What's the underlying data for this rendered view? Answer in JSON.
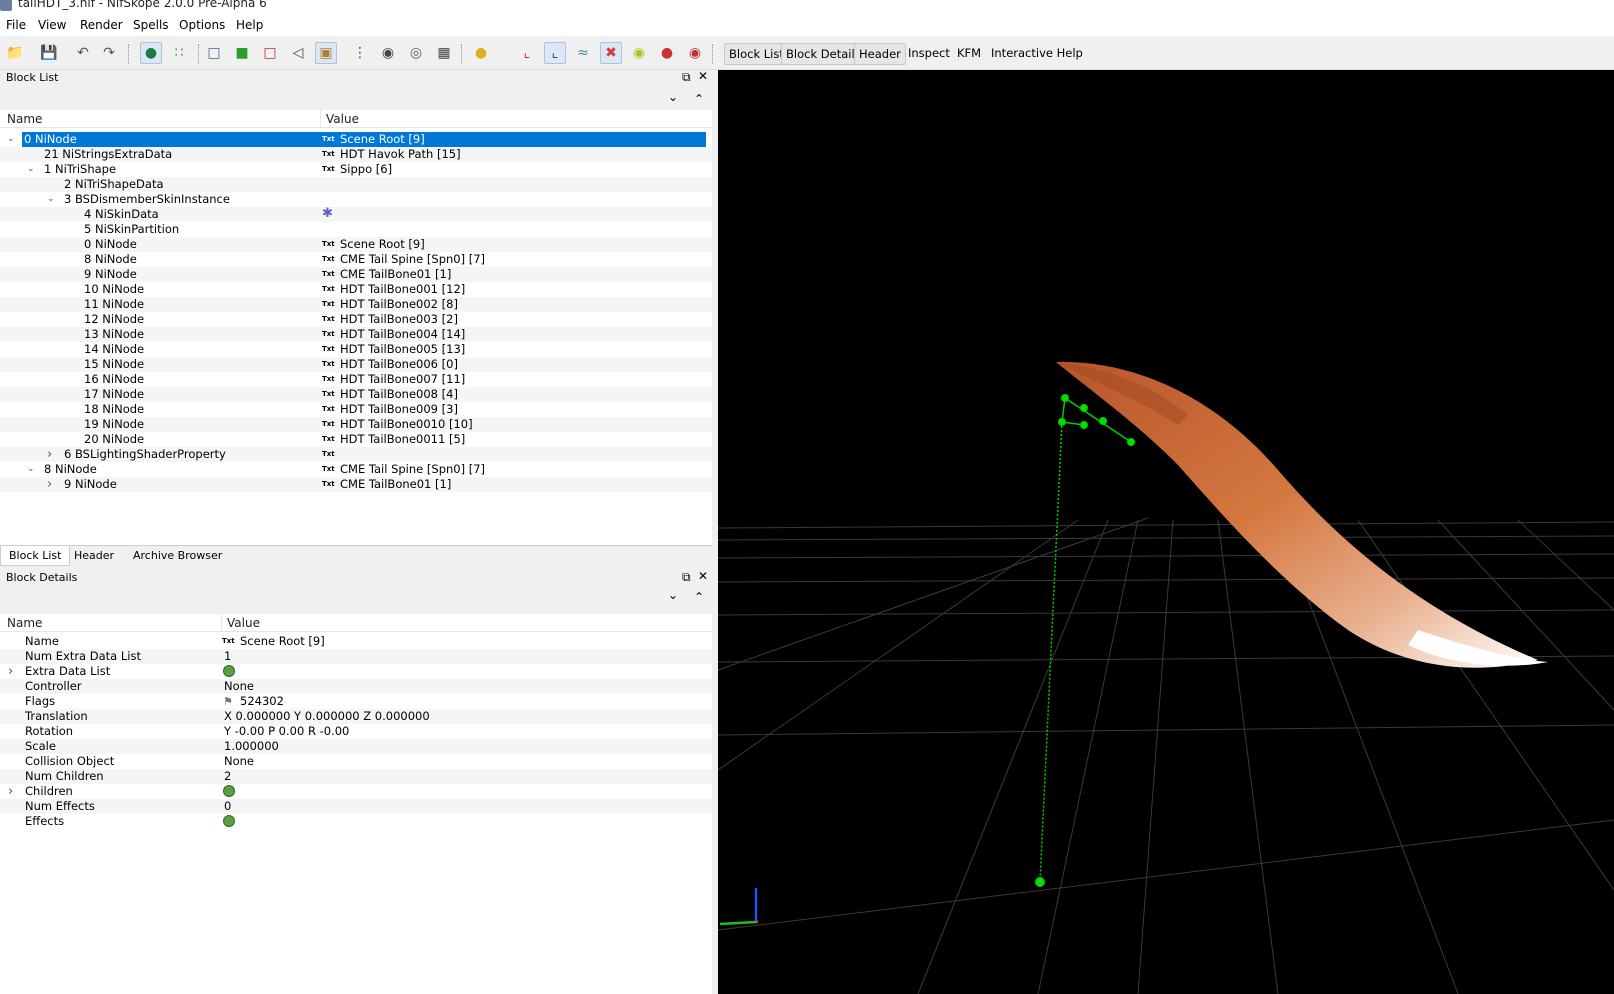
{
  "window": {
    "title": "tailHDT_3.nif - NifSkope 2.0.0 Pre-Alpha 6"
  },
  "menu": [
    "File",
    "View",
    "Render",
    "Spells",
    "Options",
    "Help"
  ],
  "toolbar": {
    "view_buttons": [
      "Block List",
      "Block Details",
      "Header",
      "Inspect",
      "KFM",
      "Interactive Help"
    ]
  },
  "block_list": {
    "title": "Block List",
    "col_name": "Name",
    "col_value": "Value",
    "rows": [
      {
        "name": "0 NiNode",
        "value": "Scene Root [9]",
        "txt": true,
        "exp": "v",
        "indent": 0
      },
      {
        "name": "21 NiStringsExtraData",
        "value": "HDT Havok Path [15]",
        "txt": true,
        "exp": "",
        "indent": 1
      },
      {
        "name": "1 NiTriShape",
        "value": "Sippo [6]",
        "txt": true,
        "exp": "v",
        "indent": 1
      },
      {
        "name": "2 NiTriShapeData",
        "value": "",
        "txt": false,
        "exp": "",
        "indent": 2
      },
      {
        "name": "3 BSDismemberSkinInstance",
        "value": "",
        "txt": false,
        "exp": "v",
        "indent": 2
      },
      {
        "name": "4 NiSkinData",
        "value": "",
        "txt": false,
        "exp": "",
        "indent": 3,
        "star": true
      },
      {
        "name": "5 NiSkinPartition",
        "value": "",
        "txt": false,
        "exp": "",
        "indent": 3
      },
      {
        "name": "0 NiNode",
        "value": "Scene Root [9]",
        "txt": true,
        "exp": "",
        "indent": 3
      },
      {
        "name": "8 NiNode",
        "value": "CME Tail Spine [Spn0] [7]",
        "txt": true,
        "exp": "",
        "indent": 3
      },
      {
        "name": "9 NiNode",
        "value": "CME TailBone01 [1]",
        "txt": true,
        "exp": "",
        "indent": 3
      },
      {
        "name": "10 NiNode",
        "value": "HDT TailBone001 [12]",
        "txt": true,
        "exp": "",
        "indent": 3
      },
      {
        "name": "11 NiNode",
        "value": "HDT TailBone002 [8]",
        "txt": true,
        "exp": "",
        "indent": 3
      },
      {
        "name": "12 NiNode",
        "value": "HDT TailBone003 [2]",
        "txt": true,
        "exp": "",
        "indent": 3
      },
      {
        "name": "13 NiNode",
        "value": "HDT TailBone004 [14]",
        "txt": true,
        "exp": "",
        "indent": 3
      },
      {
        "name": "14 NiNode",
        "value": "HDT TailBone005 [13]",
        "txt": true,
        "exp": "",
        "indent": 3
      },
      {
        "name": "15 NiNode",
        "value": "HDT TailBone006 [0]",
        "txt": true,
        "exp": "",
        "indent": 3
      },
      {
        "name": "16 NiNode",
        "value": "HDT TailBone007 [11]",
        "txt": true,
        "exp": "",
        "indent": 3
      },
      {
        "name": "17 NiNode",
        "value": "HDT TailBone008 [4]",
        "txt": true,
        "exp": "",
        "indent": 3
      },
      {
        "name": "18 NiNode",
        "value": "HDT TailBone009 [3]",
        "txt": true,
        "exp": "",
        "indent": 3
      },
      {
        "name": "19 NiNode",
        "value": "HDT TailBone0010 [10]",
        "txt": true,
        "exp": "",
        "indent": 3
      },
      {
        "name": "20 NiNode",
        "value": "HDT TailBone0011 [5]",
        "txt": true,
        "exp": "",
        "indent": 3
      },
      {
        "name": "6 BSLightingShaderProperty",
        "value": "",
        "txt": true,
        "exp": ">",
        "indent": 2
      },
      {
        "name": "8 NiNode",
        "value": "CME Tail Spine [Spn0] [7]",
        "txt": true,
        "exp": "v",
        "indent": 1
      },
      {
        "name": "9 NiNode",
        "value": "CME TailBone01 [1]",
        "txt": true,
        "exp": ">",
        "indent": 2
      }
    ]
  },
  "tabs": [
    "Block List",
    "Header",
    "Archive Browser"
  ],
  "block_details": {
    "title": "Block Details",
    "col_name": "Name",
    "col_value": "Value",
    "rows": [
      {
        "name": "Name",
        "value": "Scene Root [9]",
        "icon": "txt",
        "exp": ""
      },
      {
        "name": "Num Extra Data List",
        "value": "1",
        "icon": "",
        "exp": ""
      },
      {
        "name": "Extra Data List",
        "value": "",
        "icon": "link",
        "exp": ">"
      },
      {
        "name": "Controller",
        "value": "None",
        "icon": "",
        "exp": ""
      },
      {
        "name": "Flags",
        "value": "524302",
        "icon": "flag",
        "exp": ""
      },
      {
        "name": "Translation",
        "value": "X 0.000000 Y 0.000000 Z 0.000000",
        "icon": "",
        "exp": ""
      },
      {
        "name": "Rotation",
        "value": "Y -0.00 P 0.00 R -0.00",
        "icon": "",
        "exp": ""
      },
      {
        "name": "Scale",
        "value": "1.000000",
        "icon": "",
        "exp": ""
      },
      {
        "name": "Collision Object",
        "value": "None",
        "icon": "",
        "exp": ""
      },
      {
        "name": "Num Children",
        "value": "2",
        "icon": "",
        "exp": ""
      },
      {
        "name": "Children",
        "value": "",
        "icon": "link",
        "exp": ">"
      },
      {
        "name": "Num Effects",
        "value": "0",
        "icon": "",
        "exp": ""
      },
      {
        "name": "Effects",
        "value": "",
        "icon": "link",
        "exp": ""
      }
    ]
  },
  "colors": {
    "selection": "#0078d7",
    "viewport_bg": "#000000",
    "skeleton": "#00e000",
    "fur_base": "#c8663a",
    "fur_tip": "#ffffff"
  }
}
